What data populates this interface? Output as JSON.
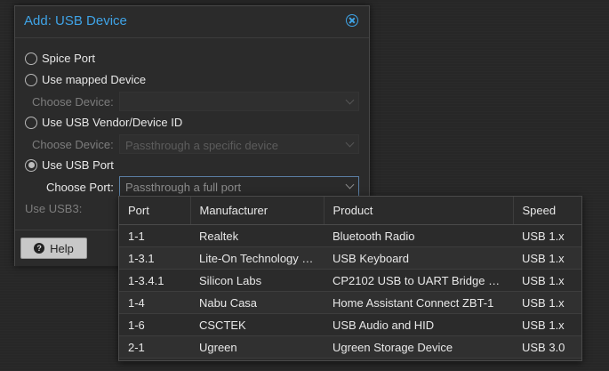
{
  "dialog": {
    "title": "Add: USB Device",
    "options": {
      "spice_port": "Spice Port",
      "mapped_device": "Use mapped Device",
      "vendor_id": "Use USB Vendor/Device ID",
      "usb_port": "Use USB Port"
    },
    "mapped_choose_label": "Choose Device:",
    "mapped_choose_value": "",
    "vendor_choose_label": "Choose Device:",
    "vendor_choose_value": "Passthrough a specific device",
    "port_choose_label": "Choose Port:",
    "port_choose_value": "Passthrough a full port",
    "use_usb3_label": "Use USB3:",
    "help_label": "Help"
  },
  "dropdown": {
    "columns": [
      "Port",
      "Manufacturer",
      "Product",
      "Speed"
    ],
    "rows": [
      {
        "port": "1-1",
        "manufacturer": "Realtek",
        "product": "Bluetooth Radio",
        "speed": "USB 1.x"
      },
      {
        "port": "1-3.1",
        "manufacturer": "Lite-On Technology …",
        "product": "USB Keyboard",
        "speed": "USB 1.x"
      },
      {
        "port": "1-3.4.1",
        "manufacturer": "Silicon Labs",
        "product": "CP2102 USB to UART Bridge …",
        "speed": "USB 1.x"
      },
      {
        "port": "1-4",
        "manufacturer": "Nabu Casa",
        "product": "Home Assistant Connect ZBT-1",
        "speed": "USB 1.x"
      },
      {
        "port": "1-6",
        "manufacturer": "CSCTEK",
        "product": "USB Audio and HID",
        "speed": "USB 1.x"
      },
      {
        "port": "2-1",
        "manufacturer": "Ugreen",
        "product": "Ugreen Storage Device",
        "speed": "USB 3.0"
      }
    ]
  },
  "colors": {
    "accent": "#3fa3e6",
    "background": "#262626",
    "dialog_bg": "#2b2b2b"
  }
}
